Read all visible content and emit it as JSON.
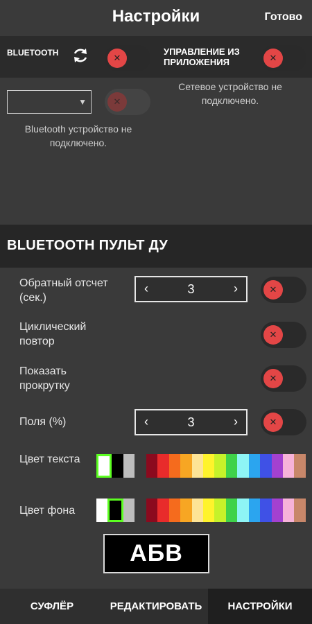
{
  "header": {
    "title": "Настройки",
    "done_label": "Готово"
  },
  "connection": {
    "bluetooth_label": "BLUETOOTH",
    "app_control_label": "УПРАВЛЕНИЕ ИЗ ПРИЛОЖЕНИЯ",
    "network_status": "Сетевое устройство не подключено.",
    "bluetooth_status": "Bluetooth устройство не подключено.",
    "device_select_value": ""
  },
  "section": {
    "title": "BLUETOOTH ПУЛЬТ ДУ"
  },
  "settings": {
    "countdown_label": "Обратный отсчет (сек.)",
    "countdown_value": "3",
    "loop_label": "Циклический повтор",
    "show_scroll_label": "Показать прокрутку",
    "margins_label": "Поля (%)",
    "margins_value": "3",
    "text_color_label": "Цвет текста",
    "bg_color_label": "Цвет фона"
  },
  "palette_colors": [
    "#ffffff",
    "#000000",
    "#bdbdbd",
    "#3a3a3a",
    "#8b0a1e",
    "#e82b2b",
    "#f56b1d",
    "#f7a623",
    "#fde496",
    "#fff32c",
    "#c6f22a",
    "#3fd24a",
    "#8ef5f5",
    "#2ba5ef",
    "#3f51e6",
    "#a341d0",
    "#f7b3d9",
    "#c8876a"
  ],
  "text_palette_selected": 0,
  "bg_palette_selected": 1,
  "preview": {
    "text": "АБВ"
  },
  "nav": {
    "tabs": [
      "СУФЛЁР",
      "РЕДАКТИРОВАТЬ",
      "НАСТРОЙКИ"
    ],
    "active": 2
  },
  "toggles": {
    "bluetooth": false,
    "app_control": false,
    "device": false,
    "countdown": false,
    "loop": false,
    "show_scroll": false,
    "margins": false
  },
  "icons": {
    "refresh": "refresh-icon",
    "toggle_off": "close-icon",
    "dropdown": "chevron-down-icon",
    "stepper_left": "chevron-left-icon",
    "stepper_right": "chevron-right-icon"
  }
}
